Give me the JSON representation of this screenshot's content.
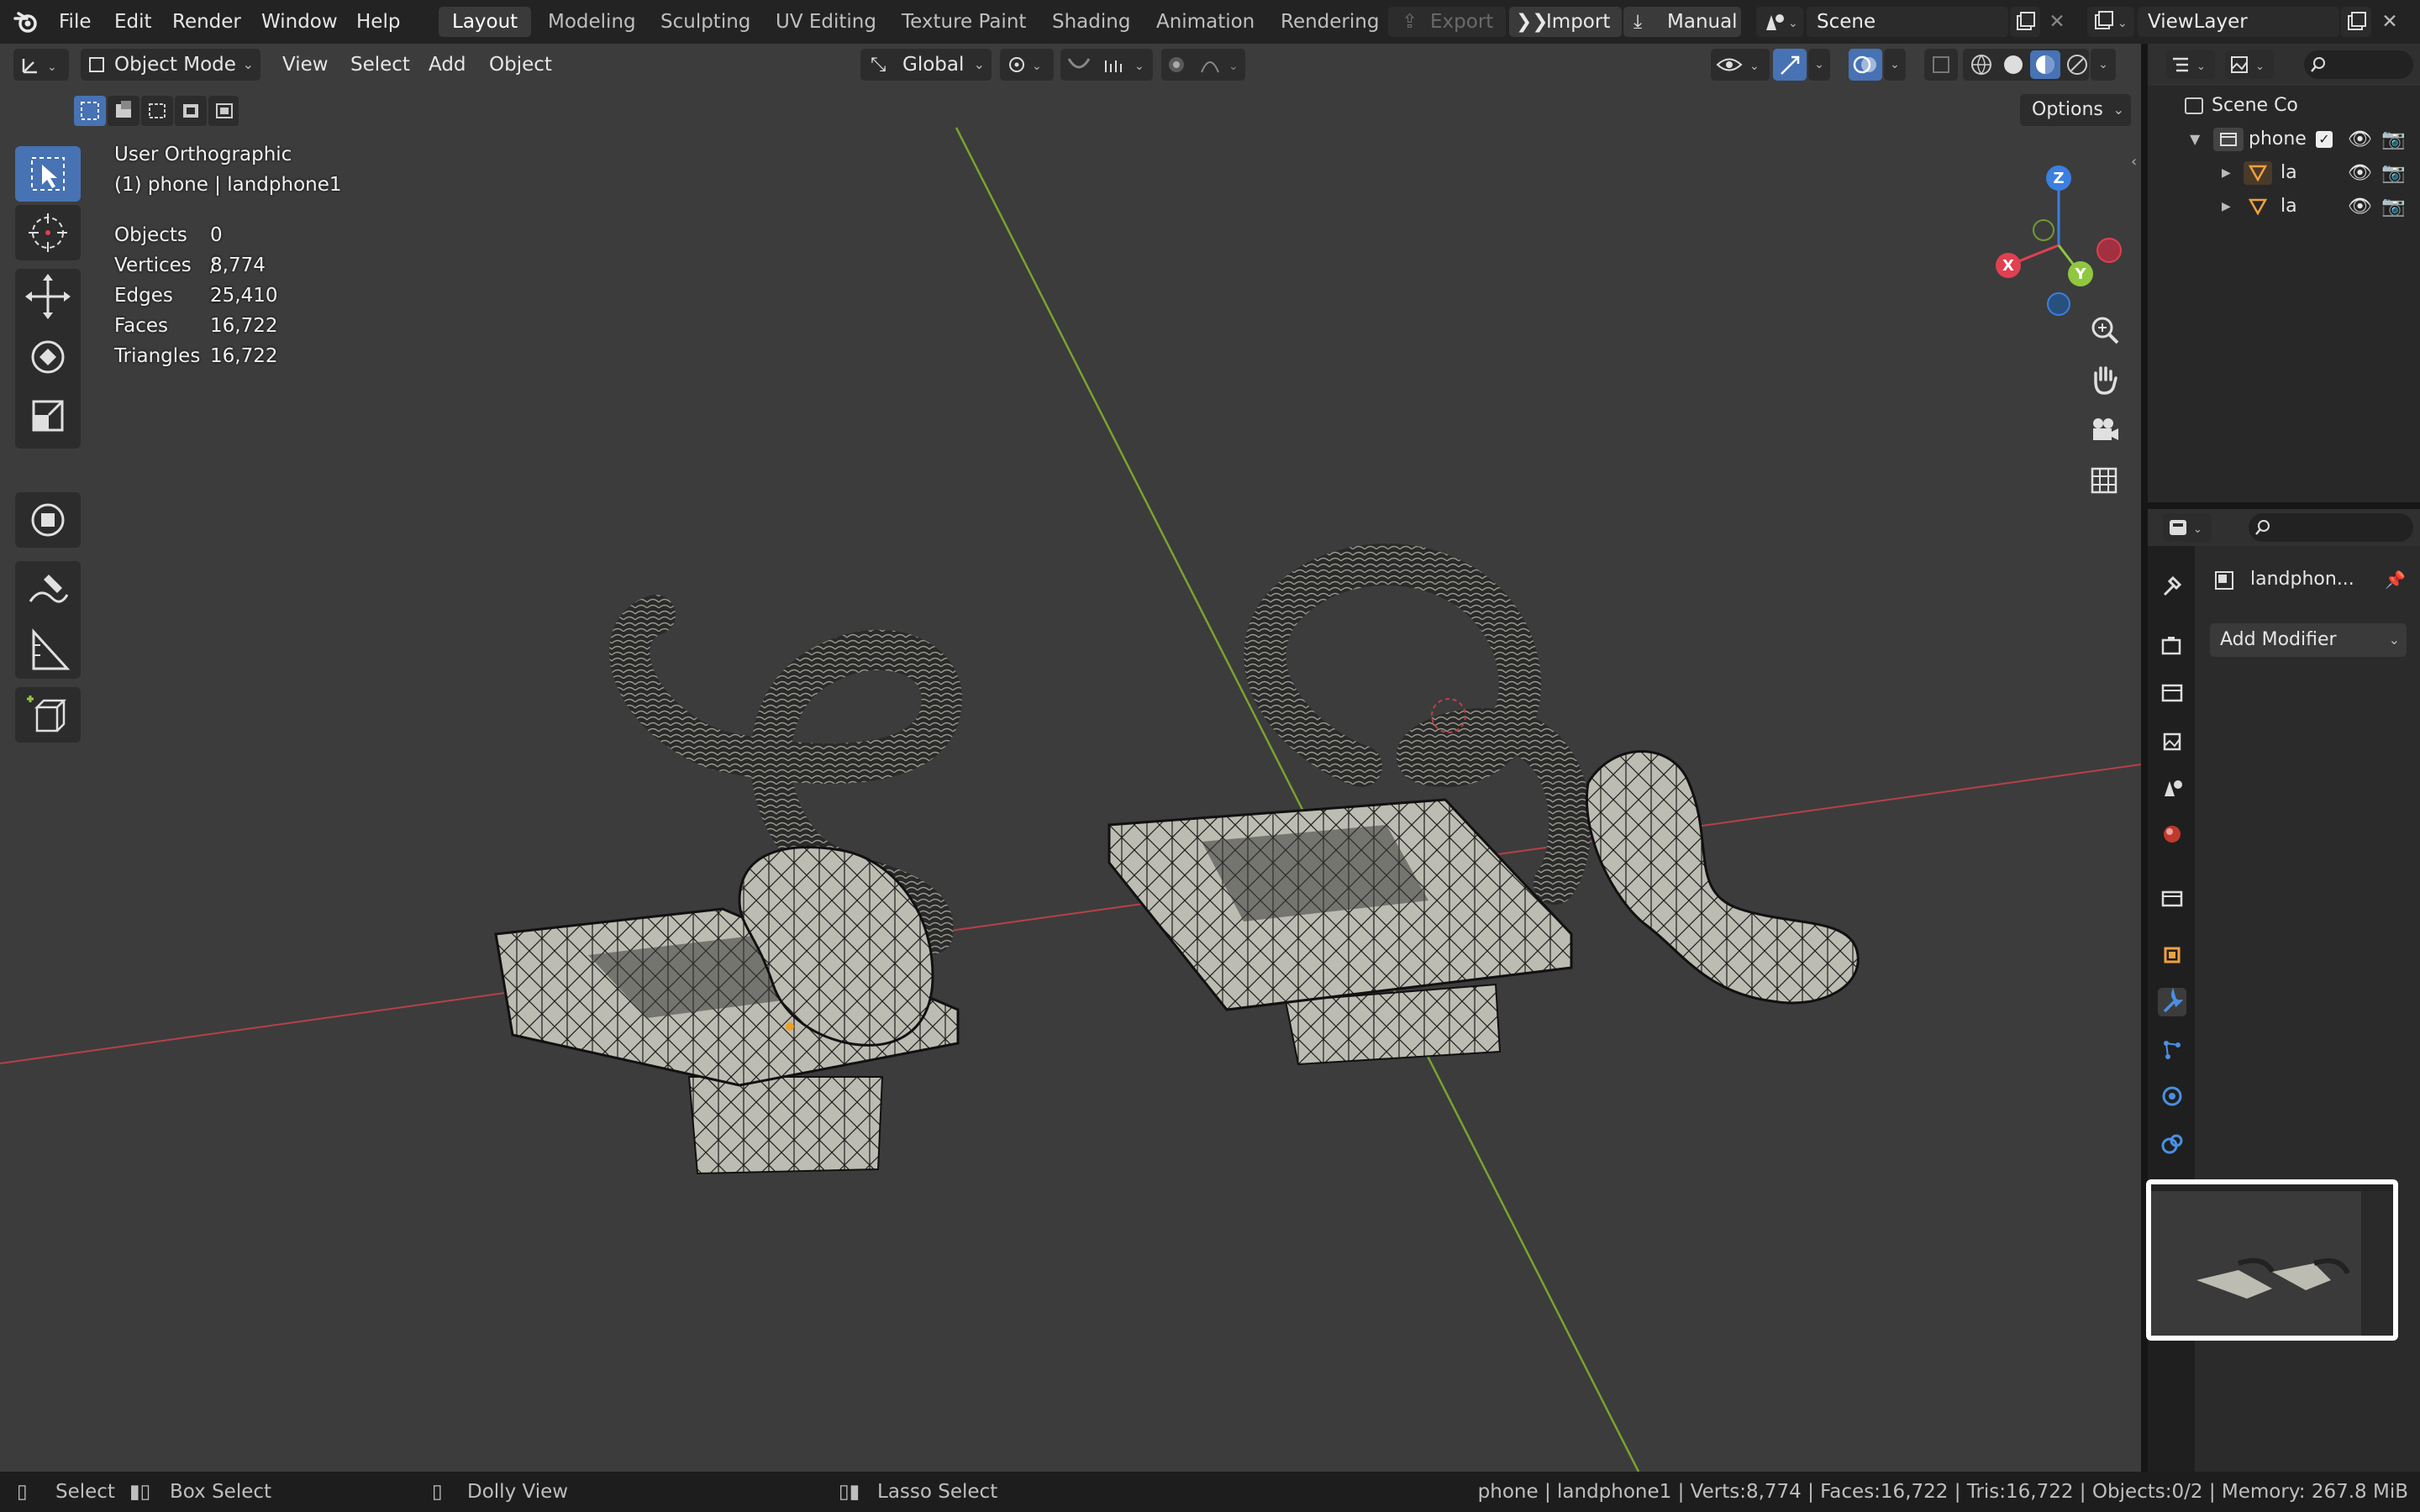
{
  "topbar": {
    "menus": [
      "File",
      "Edit",
      "Render",
      "Window",
      "Help"
    ],
    "workspaces": [
      "Layout",
      "Modeling",
      "Sculpting",
      "UV Editing",
      "Texture Paint",
      "Shading",
      "Animation",
      "Rendering"
    ],
    "active_workspace": "Layout",
    "export_label": "Export",
    "import_label": "Import",
    "manual_label": "Manual",
    "scene_name": "Scene",
    "view_layer_name": "ViewLayer"
  },
  "viewport": {
    "mode_label": "Object Mode",
    "menus": [
      "View",
      "Select",
      "Add",
      "Object"
    ],
    "transform_orientation": "Global",
    "options_label": "Options",
    "view_name": "User Orthographic",
    "active_object": "(1) phone | landphone1",
    "stats": [
      {
        "label": "Objects",
        "value": "0 / 2"
      },
      {
        "label": "Vertices",
        "value": "8,774"
      },
      {
        "label": "Edges",
        "value": "25,410"
      },
      {
        "label": "Faces",
        "value": "16,722"
      },
      {
        "label": "Triangles",
        "value": "16,722"
      }
    ],
    "gizmo_axes": {
      "x": "X",
      "y": "Y",
      "z": "Z"
    }
  },
  "outliner": {
    "scene_collection": "Scene Co",
    "collection": "phone",
    "object_1": "la",
    "object_2": "la"
  },
  "properties": {
    "object_name": "landphon...",
    "add_modifier_label": "Add Modifier"
  },
  "statusbar": {
    "select": "Select",
    "box_select": "Box Select",
    "dolly_view": "Dolly View",
    "lasso_select": "Lasso Select",
    "info": "phone | landphone1 | Verts:8,774 | Faces:16,722 | Tris:16,722 | Objects:0/2 | Memory: 267.8 MiB"
  },
  "colors": {
    "accent": "#4772b3",
    "x_axis": "#e04050",
    "y_axis": "#8fc73e",
    "z_axis": "#3b7fe0"
  }
}
